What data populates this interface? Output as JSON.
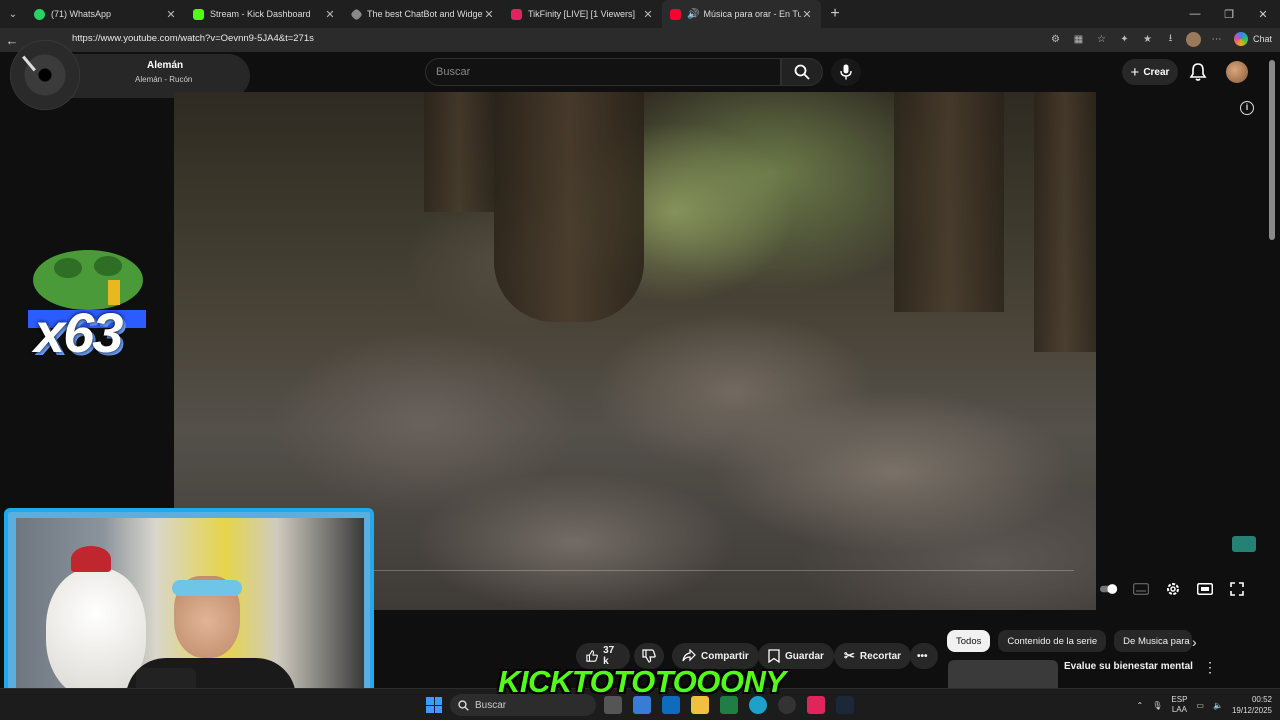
{
  "browser": {
    "tabs": [
      {
        "title": "(71) WhatsApp",
        "color": "#25d366",
        "active": false
      },
      {
        "title": "Stream - Kick Dashboard",
        "color": "#53fc18",
        "active": false
      },
      {
        "title": "The best ChatBot and Widgets for",
        "color": "#888888",
        "active": false
      },
      {
        "title": "TikFinity [LIVE] [1 Viewers]",
        "color": "#e0245e",
        "active": false
      },
      {
        "title": "Música para orar - En Tu presencia",
        "color": "#ff0033",
        "active": true
      }
    ],
    "url": "https://www.youtube.com/watch?v=Oevnn9-5JA4&t=271s",
    "copilot_label": "Chat"
  },
  "now_playing": {
    "title": "Alemán",
    "artist": "Alemán - Rucón"
  },
  "youtube": {
    "search_placeholder": "Buscar",
    "create_label": "Crear",
    "actions": {
      "likes": "37 k",
      "share": "Compartir",
      "save": "Guardar",
      "clip": "Recortar"
    },
    "chips": [
      "Todos",
      "Contenido de la serie",
      "De Musica para"
    ],
    "recommendation_title": "Evalue su bienestar mental"
  },
  "overlay": {
    "combo": "x63",
    "streamer_name": "KICKTOTOTOOONY"
  },
  "taskbar": {
    "search_label": "Buscar",
    "lang_top": "ESP",
    "lang_bottom": "LAA",
    "time": "00:52",
    "date": "19/12/2025"
  },
  "colors": {
    "kick_green": "#53fc18",
    "webcam_border": "#20a8f0",
    "youtube_bg": "#0f0f0f"
  }
}
